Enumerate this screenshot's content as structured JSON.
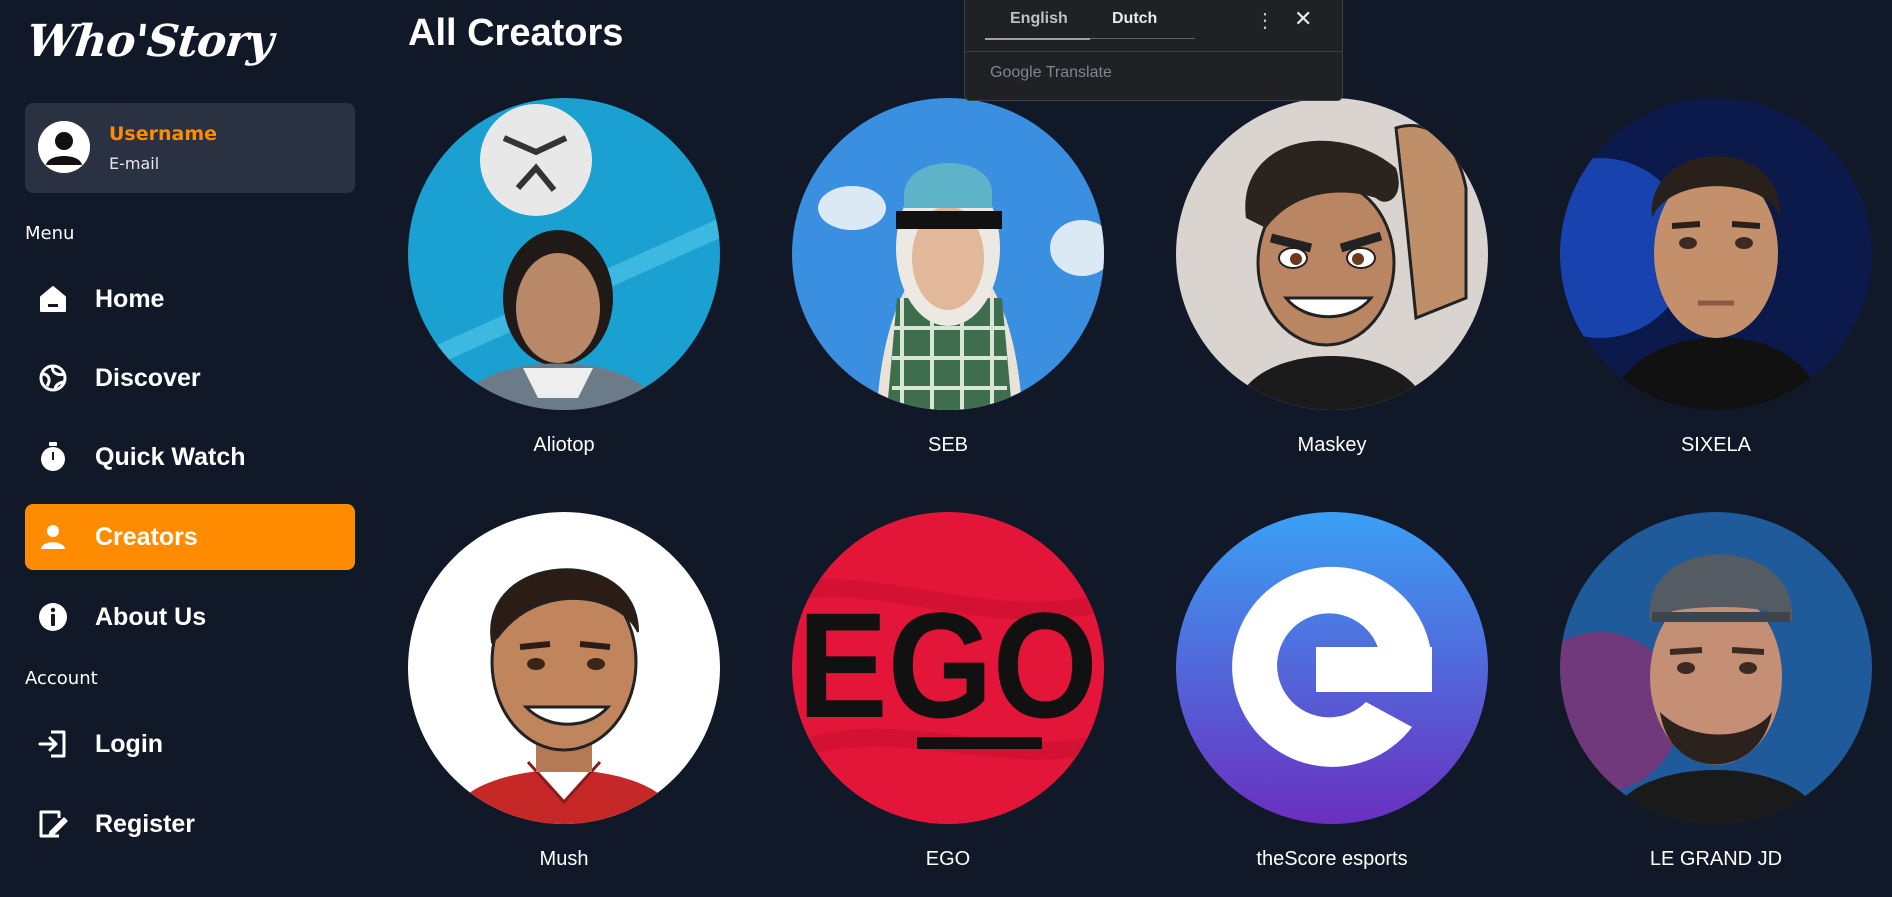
{
  "app": {
    "logo": "Who'Story"
  },
  "user": {
    "username": "Username",
    "email": "E-mail"
  },
  "sections": {
    "menu": "Menu",
    "account": "Account"
  },
  "nav": {
    "home": "Home",
    "discover": "Discover",
    "quick_watch": "Quick Watch",
    "creators": "Creators",
    "about": "About Us",
    "login": "Login",
    "register": "Register"
  },
  "page": {
    "title": "All Creators"
  },
  "creators": [
    {
      "name": "Aliotop"
    },
    {
      "name": "SEB"
    },
    {
      "name": "Maskey"
    },
    {
      "name": "SIXELA"
    },
    {
      "name": "Mush"
    },
    {
      "name": "EGO"
    },
    {
      "name": "theScore esports"
    },
    {
      "name": "LE GRAND JD"
    }
  ],
  "ego_logo_text": "EGO",
  "translate": {
    "lang_from": "English",
    "lang_to": "Dutch",
    "brand": "Google Translate"
  },
  "colors": {
    "accent": "#ff8c00",
    "background": "#111827",
    "card": "#2a3141"
  }
}
